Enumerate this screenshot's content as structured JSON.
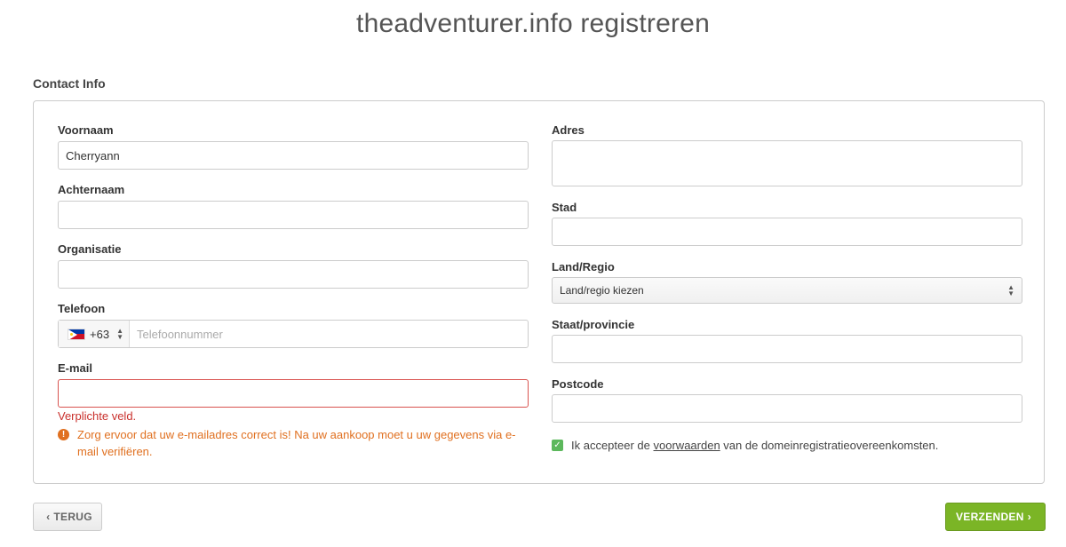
{
  "page": {
    "title": "theadventurer.info registreren"
  },
  "section": {
    "title": "Contact Info"
  },
  "form": {
    "first_name": {
      "label": "Voornaam",
      "value": "Cherryann"
    },
    "last_name": {
      "label": "Achternaam",
      "value": ""
    },
    "organization": {
      "label": "Organisatie",
      "value": ""
    },
    "phone": {
      "label": "Telefoon",
      "country_code": "+63",
      "flag": "philippines-flag-icon",
      "placeholder": "Telefoonnummer",
      "value": ""
    },
    "email": {
      "label": "E-mail",
      "value": "",
      "error": "Verplichte veld.",
      "warning": "Zorg ervoor dat uw e-mailadres correct is! Na uw aankoop moet u uw gegevens via e-mail verifiëren."
    },
    "address": {
      "label": "Adres",
      "value": ""
    },
    "city": {
      "label": "Stad",
      "value": ""
    },
    "country": {
      "label": "Land/Regio",
      "selected": "Land/regio kiezen"
    },
    "state": {
      "label": "Staat/provincie",
      "value": ""
    },
    "postcode": {
      "label": "Postcode",
      "value": ""
    },
    "agree": {
      "checked": true,
      "prefix": "Ik accepteer de",
      "link": "voorwaarden",
      "suffix": "van de domeinregistratieovereenkomsten."
    }
  },
  "buttons": {
    "back": "TERUG",
    "submit": "VERZENDEN"
  },
  "colors": {
    "submit": "#7bb526",
    "error": "#c9302c",
    "warning": "#e07020",
    "checkbox": "#5cb85c"
  }
}
